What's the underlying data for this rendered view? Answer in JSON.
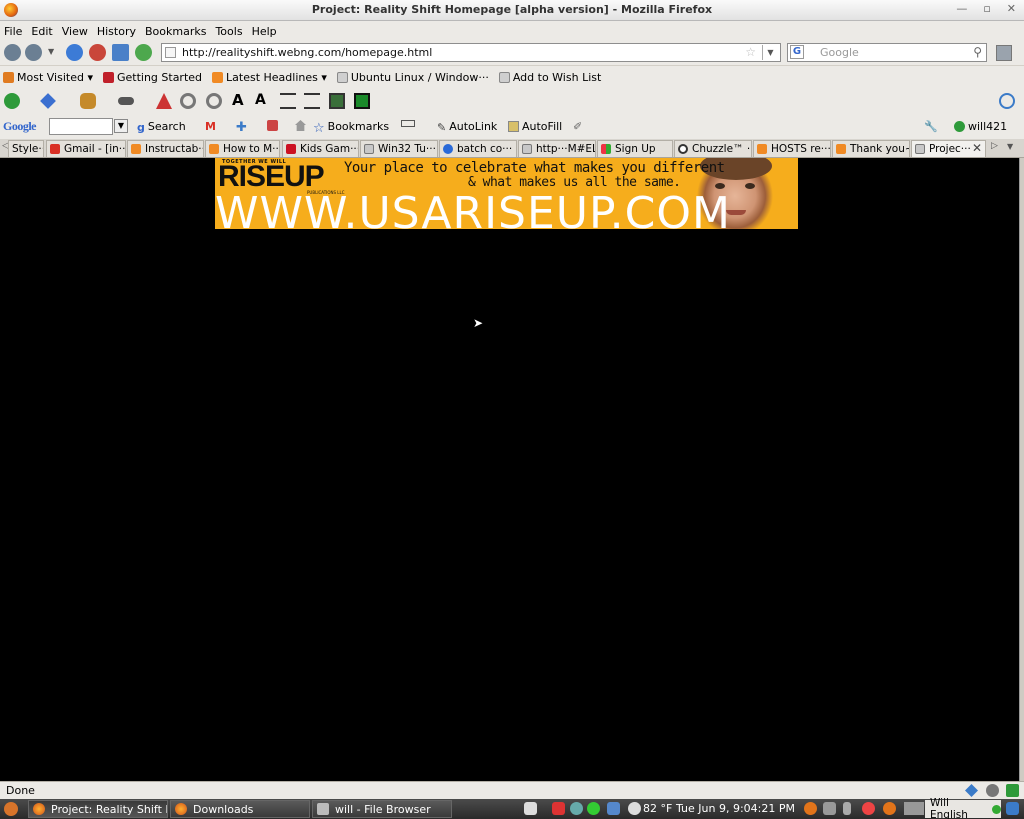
{
  "window": {
    "title": "Project: Reality Shift Homepage [alpha version] - Mozilla Firefox",
    "controls": [
      "—",
      "▫",
      "✕"
    ]
  },
  "menu": [
    "File",
    "Edit",
    "View",
    "History",
    "Bookmarks",
    "Tools",
    "Help"
  ],
  "navigation": {
    "url": "http://realityshift.webng.com/homepage.html",
    "search_placeholder": "Google"
  },
  "bookmarks_toolbar": [
    {
      "label": "Most Visited ▾",
      "color": "#e07b20"
    },
    {
      "label": "Getting Started",
      "color": "#c0202a"
    },
    {
      "label": "Latest Headlines ▾",
      "color": "#f08a24"
    },
    {
      "label": "Ubuntu Linux / Window···",
      "color": "#8a8a8a"
    },
    {
      "label": "Add to Wish List",
      "color": "#8a8a8a"
    }
  ],
  "google_toolbar": {
    "logo": "Google",
    "search": "Search",
    "bookmarks": "Bookmarks",
    "autolink": "AutoLink",
    "autofill": "AutoFill",
    "user": "will421"
  },
  "tabs": [
    {
      "label": "Style···",
      "color": "#888888"
    },
    {
      "label": "Gmail - [in···",
      "color": "#d93025"
    },
    {
      "label": "Instructab···",
      "color": "#f08a24"
    },
    {
      "label": "How to M···",
      "color": "#f08a24"
    },
    {
      "label": "Kids Gam···",
      "color": "#cc1122"
    },
    {
      "label": "Win32 Tu···",
      "color": "#888888"
    },
    {
      "label": "batch co···",
      "color": "#2a6ad8"
    },
    {
      "label": "http···M#EL",
      "color": "#888888"
    },
    {
      "label": "Sign Up",
      "color": "#2a8ad8"
    },
    {
      "label": "Chuzzle™ ···",
      "color": "#333333"
    },
    {
      "label": "HOSTS re···",
      "color": "#f08a24"
    },
    {
      "label": "Thank you~",
      "color": "#f08a24"
    },
    {
      "label": "Projec···",
      "color": "#888888"
    }
  ],
  "banner": {
    "together": "TOGETHER WE WILL",
    "brand": "RISEUP",
    "publisher": "PUBLICATIONS LLC",
    "tagline_1": "Your place to celebrate what makes you different",
    "tagline_2": "& what makes us all the same.",
    "website": "WWW.USARISEUP.COM"
  },
  "status": {
    "text": "Done"
  },
  "taskbar": {
    "windows": [
      {
        "label": "Project: Reality Shift H···",
        "active": true
      },
      {
        "label": "Downloads",
        "active": false
      },
      {
        "label": "will - File Browser",
        "active": false
      }
    ],
    "weather": "82 °F",
    "clock": "Tue Jun  9,  9:04:21 PM",
    "user": "Will English"
  }
}
